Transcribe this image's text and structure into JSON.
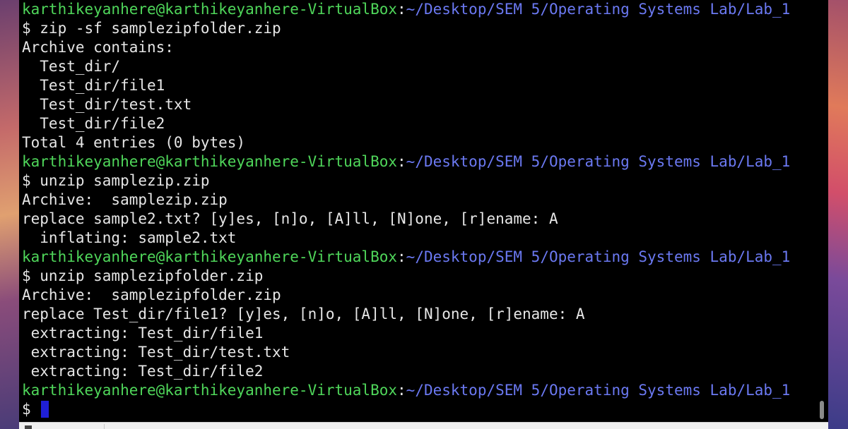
{
  "terminal": {
    "lines": [
      {
        "user": "karthikeyanhere@karthikeyanhere-VirtualBox",
        "sep": ":",
        "path": "~/Desktop/SEM 5/Operating Systems Lab/Lab_1"
      },
      {
        "text": "$ zip -sf samplezipfolder.zip"
      },
      {
        "text": "Archive contains:"
      },
      {
        "text": "  Test_dir/"
      },
      {
        "text": "  Test_dir/file1"
      },
      {
        "text": "  Test_dir/test.txt"
      },
      {
        "text": "  Test_dir/file2"
      },
      {
        "text": "Total 4 entries (0 bytes)"
      },
      {
        "user": "karthikeyanhere@karthikeyanhere-VirtualBox",
        "sep": ":",
        "path": "~/Desktop/SEM 5/Operating Systems Lab/Lab_1"
      },
      {
        "text": "$ unzip samplezip.zip"
      },
      {
        "text": "Archive:  samplezip.zip"
      },
      {
        "text": "replace sample2.txt? [y]es, [n]o, [A]ll, [N]one, [r]ename: A"
      },
      {
        "text": "  inflating: sample2.txt"
      },
      {
        "user": "karthikeyanhere@karthikeyanhere-VirtualBox",
        "sep": ":",
        "path": "~/Desktop/SEM 5/Operating Systems Lab/Lab_1"
      },
      {
        "text": "$ unzip samplezipfolder.zip"
      },
      {
        "text": "Archive:  samplezipfolder.zip"
      },
      {
        "text": "replace Test_dir/file1? [y]es, [n]o, [A]ll, [N]one, [r]ename: A"
      },
      {
        "text": " extracting: Test_dir/file1"
      },
      {
        "text": " extracting: Test_dir/test.txt"
      },
      {
        "text": " extracting: Test_dir/file2"
      },
      {
        "user": "karthikeyanhere@karthikeyanhere-VirtualBox",
        "sep": ":",
        "path": "~/Desktop/SEM 5/Operating Systems Lab/Lab_1"
      }
    ],
    "current_prompt": "$ "
  },
  "colors": {
    "user": "#4fd65a",
    "path": "#6b79f2",
    "text": "#e6e6e6",
    "cursor": "#1f1fd6",
    "background": "#000000"
  }
}
